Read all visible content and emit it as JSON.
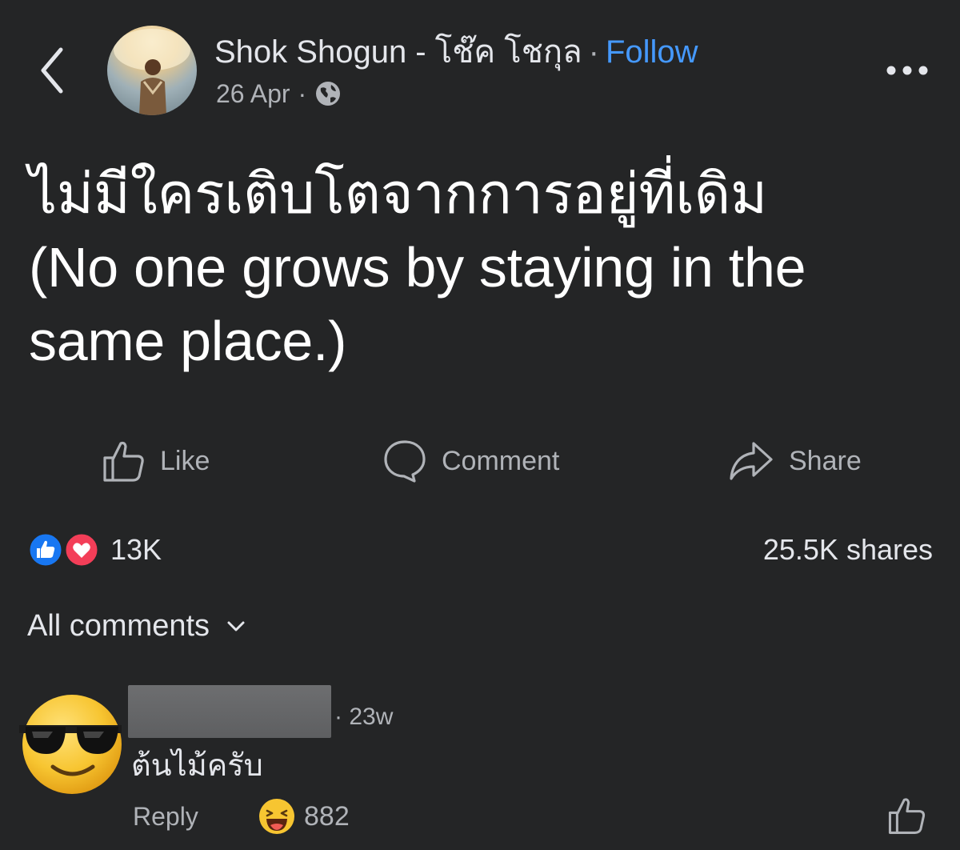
{
  "post": {
    "author": "Shok Shogun - โช๊ค โชกุล",
    "separator": "·",
    "follow_label": "Follow",
    "date": "26 Apr",
    "privacy_icon": "globe-icon",
    "text_lines": [
      "ไม่มีใครเติบโตจากการอยู่ที่เดิม",
      "(No one grows by staying in the",
      "same place.)"
    ]
  },
  "actions": {
    "like_label": "Like",
    "comment_label": "Comment",
    "share_label": "Share"
  },
  "stats": {
    "reaction_count": "13K",
    "shares_text": "25.5K shares"
  },
  "comments_filter": {
    "label": "All comments"
  },
  "comment": {
    "time": "· 23w",
    "text": "ต้นไม้ครับ",
    "reply_label": "Reply",
    "reaction_count": "882",
    "avatar_icon": "sunglasses-emoji-icon",
    "reaction_icon": "laughing-emoji-icon"
  },
  "colors": {
    "background": "#242526",
    "follow_blue": "#4599ff",
    "like_blue": "#1877f2",
    "love_red": "#f33e58"
  }
}
